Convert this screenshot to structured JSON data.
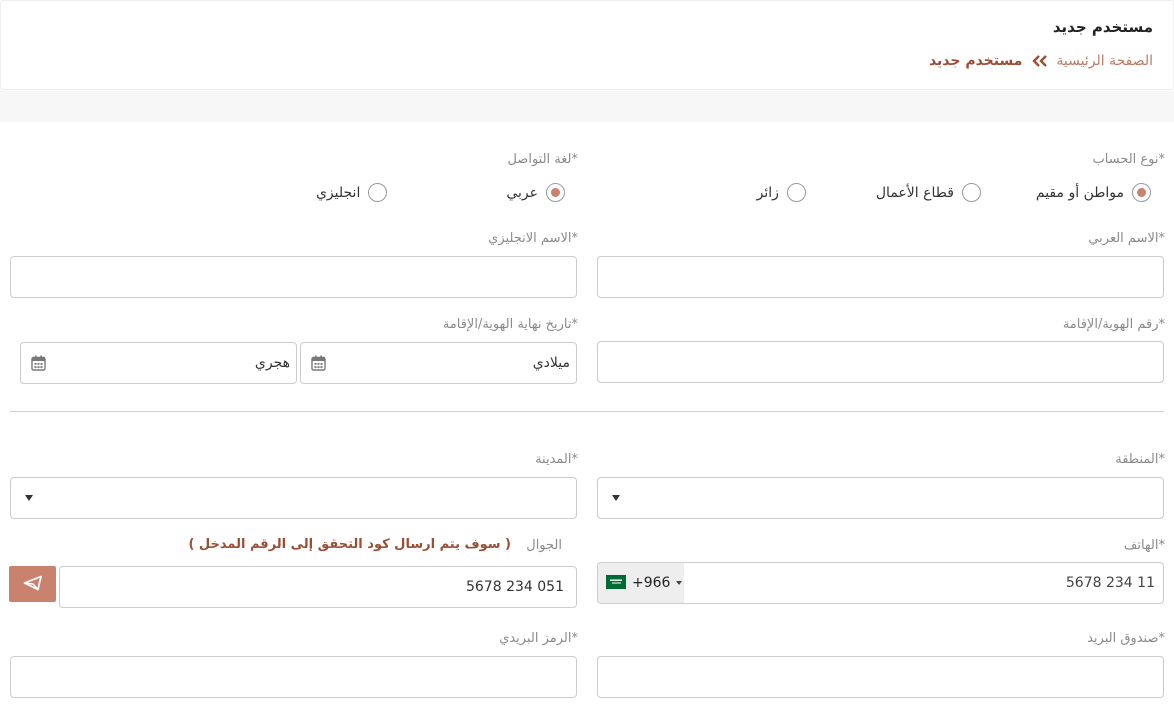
{
  "header": {
    "title": "مستخدم جديد",
    "breadcrumb_home": "الصفحة الرئيسية",
    "breadcrumb_current": "مستخدم جديد"
  },
  "account_type": {
    "label": "*نوع الحساب",
    "options": [
      "مواطن أو مقيم",
      "قطاع الأعمال",
      "زائر"
    ],
    "selected": "مواطن أو مقيم"
  },
  "language": {
    "label": "*لغة التواصل",
    "options": [
      "عربي",
      "انجليزي"
    ],
    "selected": "عربي"
  },
  "arabic_name": {
    "label": "*الاسم العربي",
    "value": ""
  },
  "english_name": {
    "label": "*الاسم الانجليزي",
    "value": ""
  },
  "id_number": {
    "label": "*رقم الهوية/الإقامة",
    "value": ""
  },
  "id_expiry": {
    "label": "*تاريخ نهاية الهوية/الإقامة",
    "gregorian_text": "ميلادي",
    "hijri_text": "هجري"
  },
  "region": {
    "label": "*المنطقة",
    "value": ""
  },
  "city": {
    "label": "*المدينة",
    "value": ""
  },
  "phone": {
    "label": "*الهاتف",
    "value": "11 234 5678",
    "dial_code": "+966"
  },
  "mobile": {
    "label": "الجوال",
    "note": "( سوف يتم ارسال كود التحقق إلى الرقم المدخل )",
    "value": "051 234 5678"
  },
  "po_box": {
    "label": "*صندوق البريد",
    "value": ""
  },
  "postal_code": {
    "label": "*الرمز البريدي",
    "value": ""
  },
  "colors": {
    "accent": "#c9826d",
    "breadcrumb_current": "#9a4f35",
    "breadcrumb_home": "#b97c67",
    "flag_green": "#006c35"
  },
  "icons": {
    "breadcrumb_separator": "double-chevron-icon",
    "calendar": "calendar-icon",
    "send": "send-icon",
    "flag": "saudi-flag-icon"
  }
}
